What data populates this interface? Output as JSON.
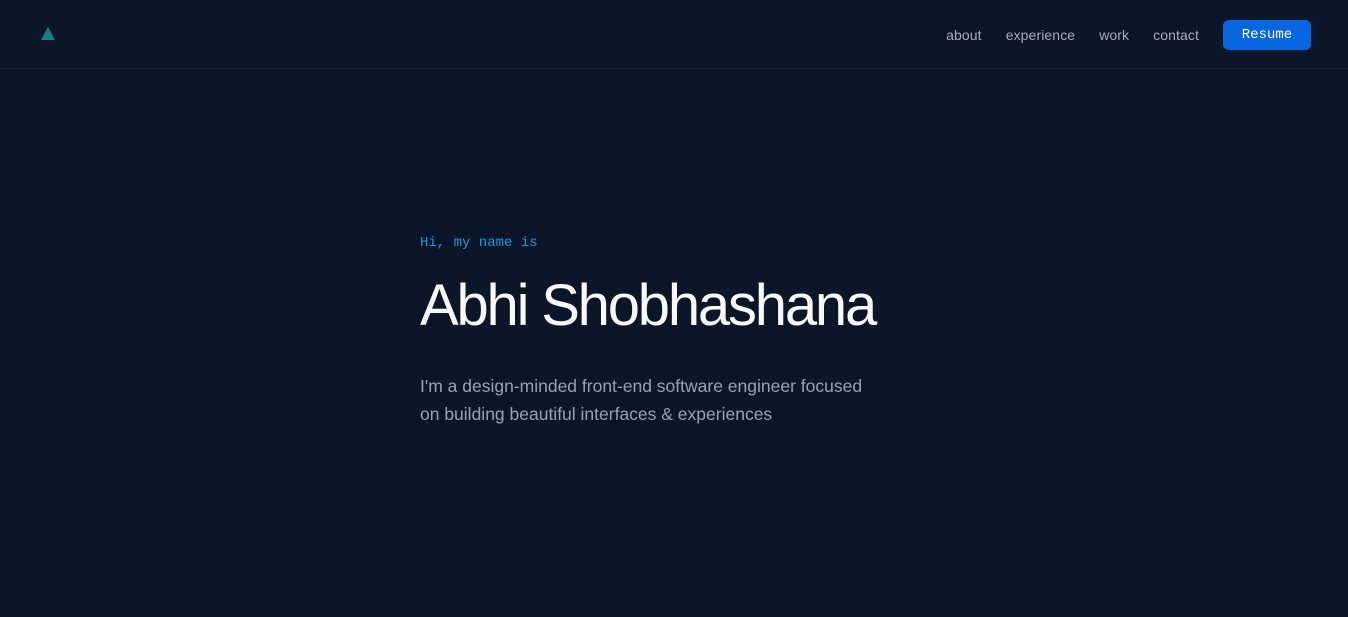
{
  "nav": {
    "logo_icon": "triangle-logo-icon",
    "logo_color": "#1b7d7f",
    "links": [
      "about",
      "experience",
      "work",
      "contact"
    ],
    "resume_label": "Resume",
    "resume_color": "#0667e1"
  },
  "hero": {
    "greeting": "Hi, my name is",
    "name": "Abhi Shobhashana",
    "tagline_line1": "I'm a design-minded front-end software engineer focused",
    "tagline_line2": "on building beautiful interfaces & experiences"
  },
  "colors": {
    "background": "#0b1628",
    "accent": "#1c98e0"
  }
}
